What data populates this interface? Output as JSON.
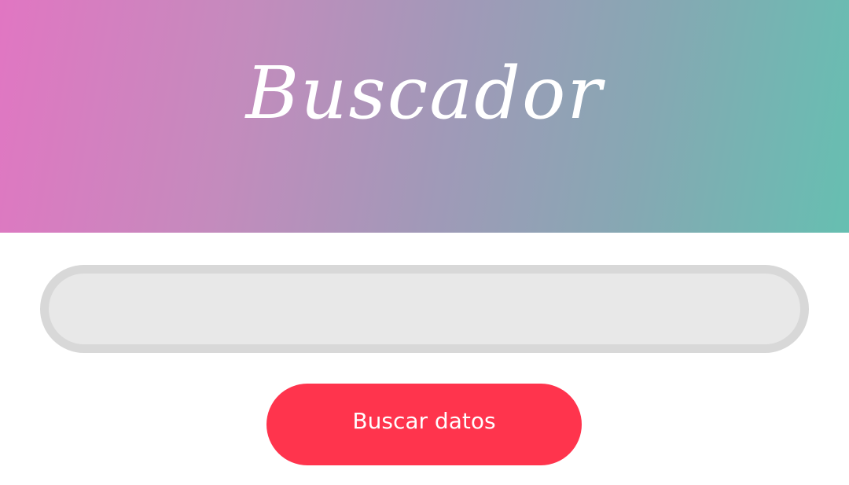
{
  "header": {
    "title": "Buscador"
  },
  "search": {
    "value": "",
    "placeholder": ""
  },
  "actions": {
    "search_button_label": "Buscar datos"
  },
  "colors": {
    "gradient_start": "#e176c2",
    "gradient_end": "#66bfb1",
    "button": "#ff344d",
    "input_background": "#e8e8e8",
    "input_border": "#d8d8d8"
  }
}
